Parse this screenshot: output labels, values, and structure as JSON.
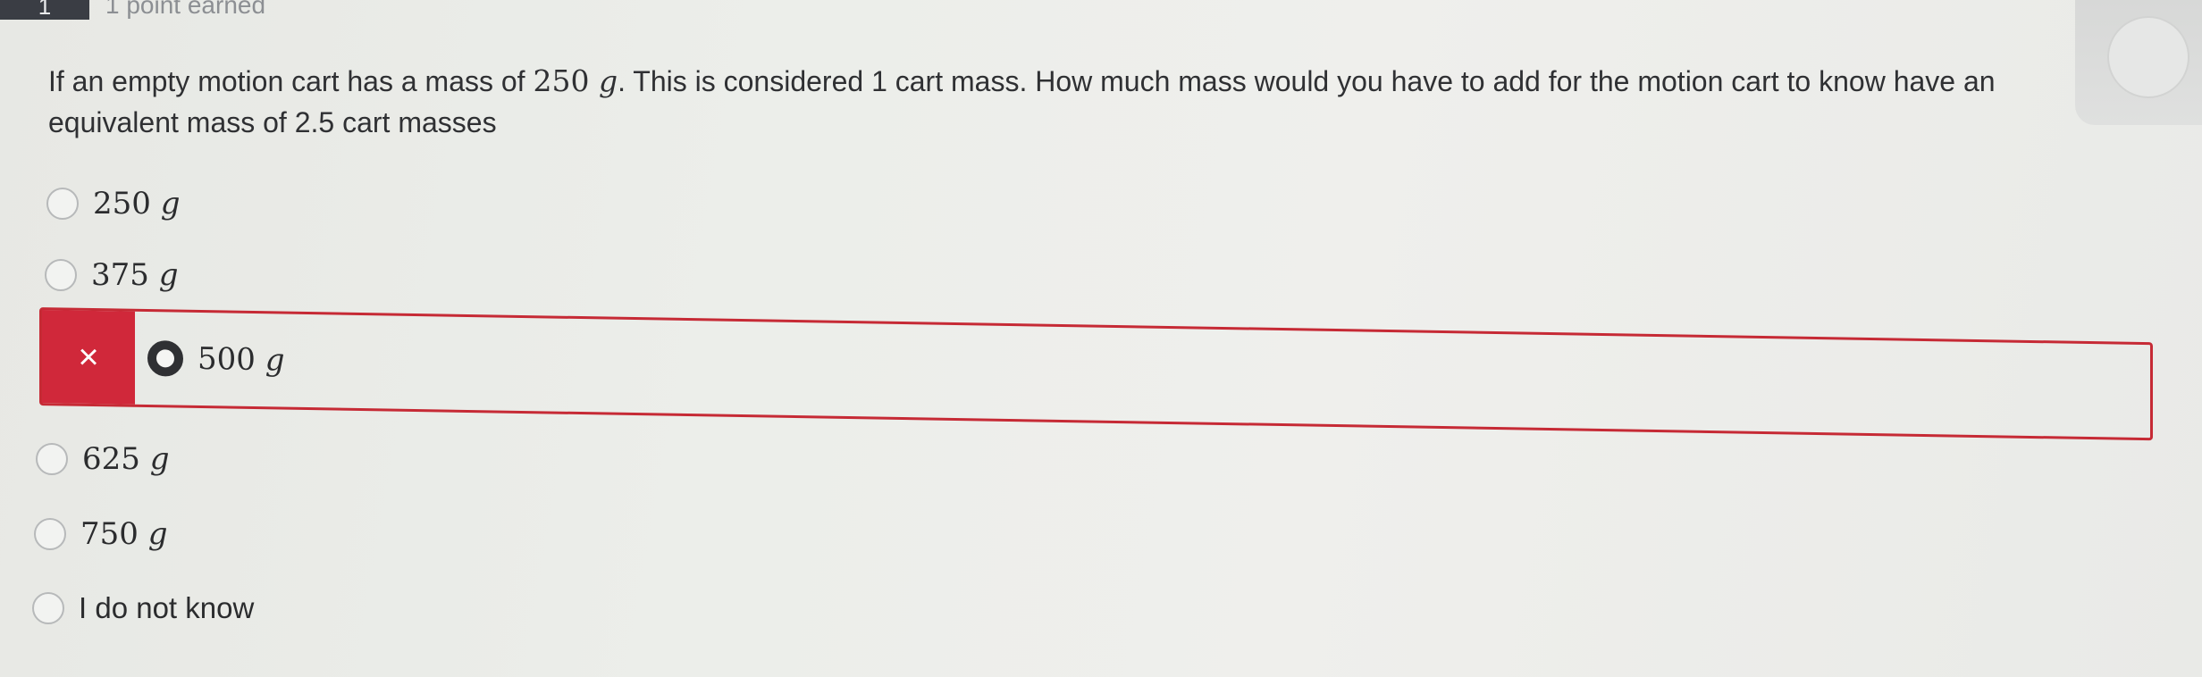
{
  "header": {
    "badge": "1",
    "points_earned": "1 point earned"
  },
  "question": {
    "part1": "If an empty motion cart has a mass of ",
    "mass_value": "250",
    "mass_unit": "g",
    "part2": ". This is considered 1 cart mass. How much mass would you have to add for the motion cart to know have an equivalent mass of 2.5 cart masses"
  },
  "options": [
    {
      "value": "250",
      "unit": "g"
    },
    {
      "value": "375",
      "unit": "g"
    },
    {
      "value": "500",
      "unit": "g",
      "selected": true,
      "result": "incorrect"
    },
    {
      "value": "625",
      "unit": "g"
    },
    {
      "value": "750",
      "unit": "g"
    },
    {
      "text": "I do not know"
    }
  ],
  "feedback": {
    "wrong_mark": "×"
  },
  "colors": {
    "incorrect": "#d0283a",
    "badge": "#3a3d44"
  },
  "icons": {
    "wrong": "close-icon",
    "selected_radio": "radio-selected-icon"
  }
}
